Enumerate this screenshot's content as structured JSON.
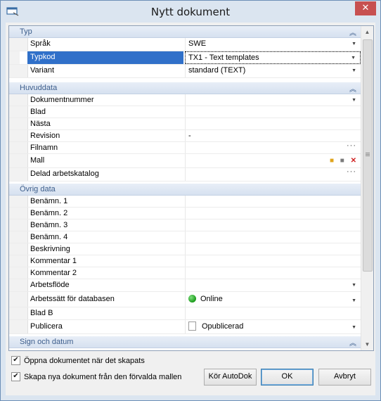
{
  "window": {
    "title": "Nytt dokument",
    "close_symbol": "✕"
  },
  "sections": {
    "typ": "Typ",
    "huvuddata": "Huvuddata",
    "ovrig": "Övrig data",
    "sign": "Sign och datum"
  },
  "collapse_glyph": "︽",
  "dropdown_glyph": "▼",
  "ellipsis_glyph": "···",
  "typ_rows": [
    {
      "label": "Språk",
      "value": "SWE"
    },
    {
      "label": "Typkod",
      "value": "TX1 - Text templates"
    },
    {
      "label": "Variant",
      "value": "standard (TEXT)"
    }
  ],
  "huvud_rows": [
    {
      "label": "Dokumentnummer",
      "value": ""
    },
    {
      "label": "Blad",
      "value": ""
    },
    {
      "label": "Nästa",
      "value": ""
    },
    {
      "label": "Revision",
      "value": "-"
    },
    {
      "label": "Filnamn",
      "value": ""
    },
    {
      "label": "Mall",
      "value": ""
    },
    {
      "label": "Delad arbetskatalog",
      "value": ""
    }
  ],
  "ovrig_rows": [
    {
      "label": "Benämn. 1",
      "value": ""
    },
    {
      "label": "Benämn. 2",
      "value": ""
    },
    {
      "label": "Benämn. 3",
      "value": ""
    },
    {
      "label": "Benämn. 4",
      "value": ""
    },
    {
      "label": "Beskrivning",
      "value": ""
    },
    {
      "label": "Kommentar 1",
      "value": ""
    },
    {
      "label": "Kommentar 2",
      "value": ""
    },
    {
      "label": "Arbetsflöde",
      "value": ""
    },
    {
      "label": "Arbetssätt för databasen",
      "value": "Online"
    },
    {
      "label": "Blad B",
      "value": ""
    },
    {
      "label": "Publicera",
      "value": "Opublicerad"
    }
  ],
  "checkboxes": {
    "open_doc": {
      "label": "Öppna dokumentet när det skapats",
      "checked": true
    },
    "default_template": {
      "label": "Skapa nya dokument från den förvalda mallen",
      "checked": true
    }
  },
  "buttons": {
    "autodok": "Kör AutoDok",
    "ok": "OK",
    "cancel": "Avbryt"
  },
  "colors": {
    "selection": "#3070c9",
    "online": "#1a9a1a",
    "section_text": "#3d5e8c"
  }
}
